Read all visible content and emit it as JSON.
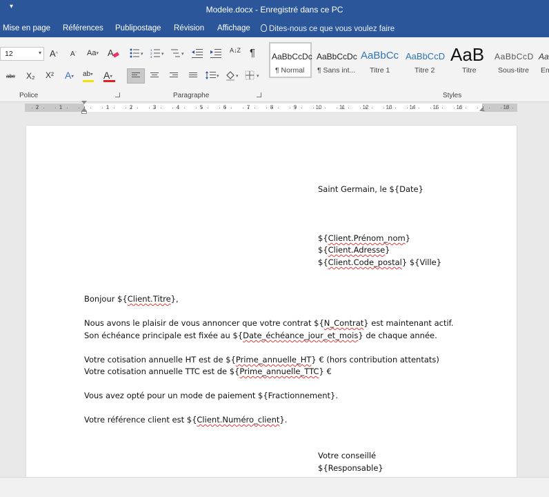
{
  "window": {
    "qat_icon": "customize-arrow",
    "title": "Modele.docx  -  Enregistré dans ce PC"
  },
  "menu": {
    "tabs": [
      "Mise en page",
      "Références",
      "Publipostage",
      "Révision",
      "Affichage"
    ],
    "tell_me": "Dites-nous ce que vous voulez faire"
  },
  "ribbon": {
    "font": {
      "size": "12",
      "grow_label": "A",
      "shrink_label": "A",
      "case_label": "Aa",
      "strike_label": "abc",
      "subscript_label": "X₂",
      "superscript_label": "X²",
      "effects_label": "A",
      "highlight_label": "ab",
      "color_label": "A",
      "highlight_color": "#f5e200",
      "font_color": "#e02020",
      "group_label": "Police"
    },
    "paragraph": {
      "sort_label": "A↓Z",
      "pilcrow": "¶",
      "group_label": "Paragraphe"
    },
    "styles": {
      "items": [
        {
          "sample": "AaBbCcDc",
          "name": "¶ Normal"
        },
        {
          "sample": "AaBbCcDc",
          "name": "¶ Sans int..."
        },
        {
          "sample": "AaBbCc",
          "name": "Titre 1"
        },
        {
          "sample": "AaBbCcD",
          "name": "Titre 2"
        },
        {
          "sample": "AaB",
          "name": "Titre"
        },
        {
          "sample": "AaBbCcD",
          "name": "Sous-titre"
        },
        {
          "sample": "Aa",
          "name": "Em"
        }
      ],
      "group_label": "Styles"
    }
  },
  "ruler": {
    "labels": [
      "2",
      "1",
      "1",
      "2",
      "3",
      "4",
      "5",
      "6",
      "7",
      "8",
      "9",
      "10",
      "11",
      "12",
      "13",
      "14",
      "15",
      "16",
      "18"
    ]
  },
  "document": {
    "date_line": "Saint Germain, le ${Date}",
    "address": {
      "name_pre": "${",
      "name_sq": "Client.Prénom_nom",
      "name_post": "}",
      "adresse_pre": "${",
      "adresse_sq": "Client.Adresse",
      "adresse_post": "}",
      "cp_pre": "${",
      "cp_sq": "Client.Code_postal",
      "cp_post": "} ${Ville}"
    },
    "greeting_pre": "Bonjour ${",
    "greeting_sq": "Client.Titre",
    "greeting_post": "},",
    "p1_l1_pre": "Nous avons le plaisir de vous annoncer que votre contrat ${",
    "p1_l1_sq": "N_Contrat",
    "p1_l1_post": "} est maintenant actif.",
    "p1_l2_pre": "Son échéance principale est fixée au ${",
    "p1_l2_sq": "Date_échéance_jour_et_mois",
    "p1_l2_post": "} de chaque année.",
    "p2_l1_pre": "Votre cotisation annuelle HT est de ${",
    "p2_l1_sq": "Prime_annuelle_HT",
    "p2_l1_post": "} € (hors contribution attentats)",
    "p2_l2_pre": "Votre cotisation annuelle TTC est de ${",
    "p2_l2_sq": "Prime_annuelle_TTC",
    "p2_l2_post": "} €",
    "p3": "Vous avez opté pour un mode de paiement ${Fractionnement}.",
    "p4_pre": "Votre référence client est ${",
    "p4_sq": "Client.Numéro_client",
    "p4_post": "}.",
    "sign_1": "Votre conseillé",
    "sign_2": "${Responsable}"
  }
}
